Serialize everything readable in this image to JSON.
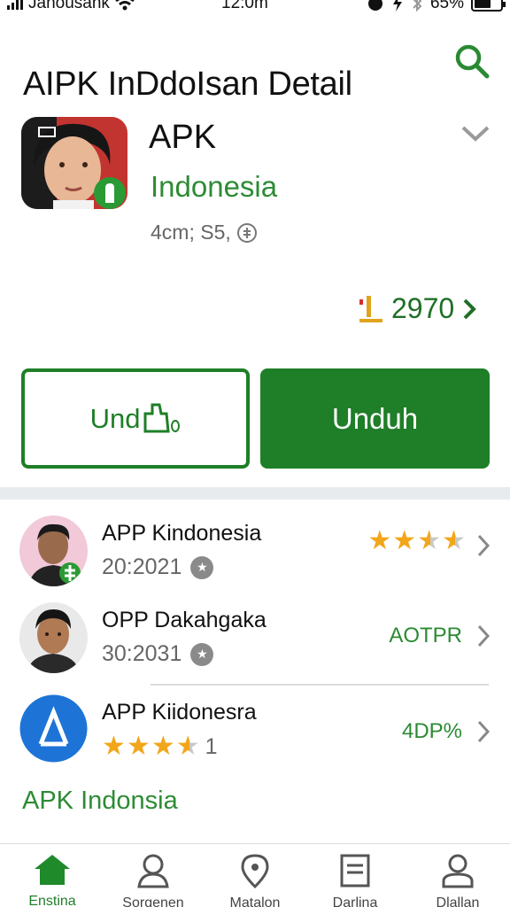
{
  "status_bar": {
    "carrier": "Janousank",
    "time": "12:0m",
    "battery_text": "65%",
    "battery_level": 0.65
  },
  "header": {
    "title": "AIPK InDdoIsan Detail",
    "search_icon": "search-icon"
  },
  "app": {
    "name": "APK",
    "region": "Indonesia",
    "meta": "4cm; S5,",
    "rank": "2970",
    "accent_color": "#1f7e28"
  },
  "actions": {
    "outline_label": "Und",
    "solid_label": "Unduh"
  },
  "list": [
    {
      "title": "APP Kindonesia",
      "sub": "20:2021",
      "rating": 3.5
    },
    {
      "title": "OPP Dakahgaka",
      "sub": "30:2031",
      "value": "AOTPR"
    },
    {
      "title": "APP Kiidonesra",
      "rating": 3.5,
      "rating_count": "1",
      "value": "4DP%"
    }
  ],
  "footer_link": "APK Indonsia",
  "tabs": [
    {
      "label": "Enstina",
      "icon": "home-icon",
      "active": true
    },
    {
      "label": "Sorgenen",
      "icon": "person-icon"
    },
    {
      "label": "Matalon",
      "icon": "location-pin-icon"
    },
    {
      "label": "Darlina",
      "icon": "list-icon"
    },
    {
      "label": "Dlallan",
      "icon": "profile-icon"
    }
  ]
}
